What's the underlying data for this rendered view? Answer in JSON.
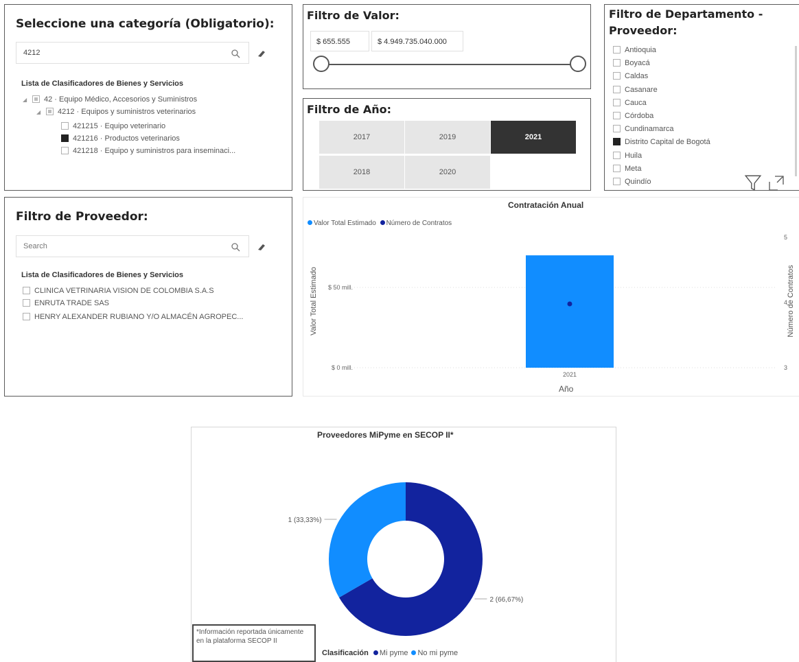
{
  "category_filter": {
    "title": "Seleccione una categoría (Obligatorio):",
    "search_value": "4212",
    "list_header": "Lista de Clasificadores de Bienes y Servicios",
    "tree": [
      {
        "label": "42 · Equipo Médico, Accesorios y Suministros",
        "state": "partial"
      },
      {
        "label": "4212 · Equipos y suministros veterinarios",
        "state": "partial"
      },
      {
        "label": "421215 · Equipo veterinario",
        "state": "unchecked"
      },
      {
        "label": "421216 · Productos veterinarios",
        "state": "checked"
      },
      {
        "label": "421218 · Equipo y suministros para inseminaci...",
        "state": "unchecked"
      }
    ]
  },
  "value_filter": {
    "title": "Filtro de Valor:",
    "min": "$ 655.555",
    "max": "$ 4.949.735.040.000"
  },
  "year_filter": {
    "title": "Filtro de Año:",
    "years": [
      "2017",
      "2019",
      "2021",
      "2018",
      "2020"
    ],
    "selected": "2021"
  },
  "dept_filter": {
    "title_line1": "Filtro de Departamento -",
    "title_line2": "Proveedor:",
    "items": [
      {
        "label": "Antioquia",
        "checked": false
      },
      {
        "label": "Boyacá",
        "checked": false
      },
      {
        "label": "Caldas",
        "checked": false
      },
      {
        "label": "Casanare",
        "checked": false
      },
      {
        "label": "Cauca",
        "checked": false
      },
      {
        "label": "Córdoba",
        "checked": false
      },
      {
        "label": "Cundinamarca",
        "checked": false
      },
      {
        "label": "Distrito Capital de Bogotá",
        "checked": true
      },
      {
        "label": "Huila",
        "checked": false
      },
      {
        "label": "Meta",
        "checked": false
      },
      {
        "label": "Quindío",
        "checked": false
      }
    ],
    "icons": [
      "filter-icon",
      "focus-mode-icon"
    ]
  },
  "provider_filter": {
    "title": "Filtro de Proveedor:",
    "search_placeholder": "Search",
    "list_header": "Lista de Clasificadores de Bienes y Servicios",
    "items": [
      "CLINICA VETRINARIA VISION DE COLOMBIA S.A.S",
      "ENRUTA TRADE SAS",
      "HENRY ALEXANDER RUBIANO Y/O ALMACÉN AGROPEC..."
    ]
  },
  "annual_chart": {
    "legend_value": "Valor Total Estimado",
    "legend_count": "Número de Contratos",
    "left_axis_label": "Valor Total Estimado",
    "right_axis_label": "Número de Contratos",
    "x_axis_label": "Año",
    "left_ticks": [
      "$ 50 mill.",
      "$ 0 mill."
    ],
    "right_ticks": [
      "5",
      "4",
      "3"
    ],
    "colors": {
      "value": "#118DFF",
      "count": "#12239E"
    }
  },
  "mipyme_chart": {
    "legend_title": "Clasificación",
    "colors": {
      "Mi pyme": "#12239E",
      "No mi pyme": "#118DFF"
    }
  },
  "note": {
    "text": "*Información reportada únicamente en la plataforma SECOP II"
  },
  "chart_data": [
    {
      "type": "bar",
      "title": "Contratación Anual",
      "categories": [
        "2021"
      ],
      "series": [
        {
          "name": "Valor Total Estimado",
          "values": [
            70
          ],
          "unit": "mill."
        },
        {
          "name": "Número de Contratos",
          "values": [
            4
          ],
          "axis": "secondary",
          "style": "point"
        }
      ],
      "xlabel": "Año",
      "ylabel": "Valor Total Estimado",
      "y2label": "Número de Contratos",
      "ylim": [
        0,
        80
      ],
      "y2lim": [
        3,
        5
      ],
      "legend": "top-left"
    },
    {
      "type": "pie",
      "title": "Proveedores MiPyme en SECOP II*",
      "donut": true,
      "slices": [
        {
          "label": "Mi pyme",
          "value": 2,
          "text": "2 (66,67%)"
        },
        {
          "label": "No mi pyme",
          "value": 1,
          "text": "1 (33,33%)"
        }
      ],
      "legend": "bottom"
    }
  ]
}
